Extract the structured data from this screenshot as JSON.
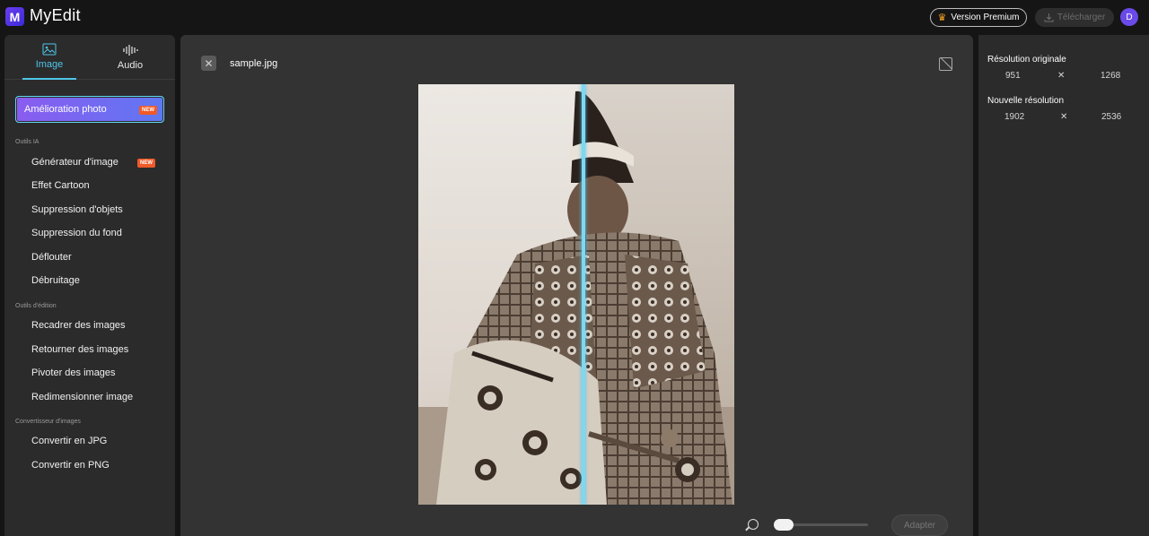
{
  "app": {
    "name": "MyEdit",
    "logo_letter": "M"
  },
  "header": {
    "premium_label": "Version Premium",
    "download_label": "Télécharger",
    "avatar_initial": "D"
  },
  "sidebar": {
    "tabs": [
      {
        "label": "Image",
        "icon": "image-icon",
        "active": true
      },
      {
        "label": "Audio",
        "icon": "audio-wave-icon",
        "active": false
      }
    ],
    "featured": {
      "label": "Amélioration photo",
      "badge": "NEW"
    },
    "sections": [
      {
        "title": "Outils IA",
        "items": [
          {
            "label": "Générateur d'image",
            "badge": "NEW"
          },
          {
            "label": "Effet Cartoon"
          },
          {
            "label": "Suppression d'objets"
          },
          {
            "label": "Suppression du fond"
          },
          {
            "label": "Déflouter"
          },
          {
            "label": "Débruitage"
          }
        ]
      },
      {
        "title": "Outils d'édition",
        "items": [
          {
            "label": "Recadrer des images"
          },
          {
            "label": "Retourner des images"
          },
          {
            "label": "Pivoter des images"
          },
          {
            "label": "Redimensionner image"
          }
        ]
      },
      {
        "title": "Convertisseur d'images",
        "items": [
          {
            "label": "Convertir en JPG"
          },
          {
            "label": "Convertir en PNG"
          }
        ]
      }
    ]
  },
  "canvas": {
    "close_icon": "close-icon",
    "filename": "sample.jpg",
    "zoom_level": 0.1,
    "adapt_label": "Adapter"
  },
  "resolution": {
    "original_label": "Résolution originale",
    "original_w": "951",
    "original_h": "1268",
    "new_label": "Nouvelle résolution",
    "new_w": "1902",
    "new_h": "2536",
    "separator": "✕"
  },
  "colors": {
    "accent": "#4fc4e8",
    "badge": "#f05a28",
    "featured_gradient_start": "#8a5cf0",
    "featured_gradient_end": "#5f77f2"
  }
}
